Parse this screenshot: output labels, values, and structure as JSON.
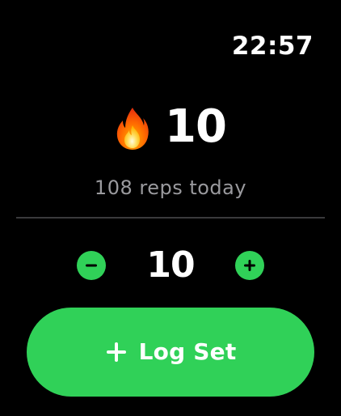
{
  "status_bar": {
    "time": "22:57"
  },
  "streak": {
    "icon": "flame-icon",
    "value": "10"
  },
  "reps_today": {
    "text": "108 reps today"
  },
  "stepper": {
    "value": "10",
    "decrement_icon": "minus-icon",
    "increment_icon": "plus-icon"
  },
  "log_button": {
    "icon": "plus-icon",
    "label": "Log Set"
  },
  "colors": {
    "accent": "#30d158",
    "background": "#000000",
    "secondary_text": "#9a9a9e",
    "divider": "#3a3a3c"
  }
}
